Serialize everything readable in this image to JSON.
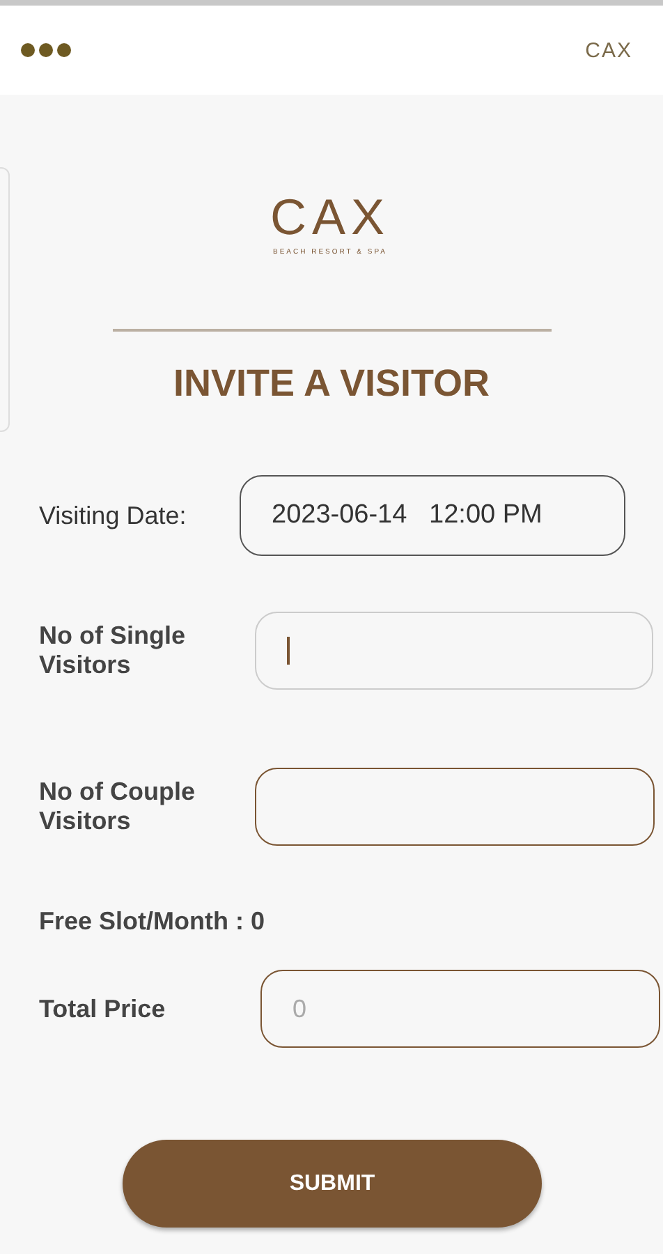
{
  "header": {
    "logo": "CAX"
  },
  "brand": {
    "logo": "CAX",
    "tagline": "BEACH RESORT & SPA"
  },
  "title": "INVITE A VISITOR",
  "fields": [
    {
      "kind": "date",
      "label": "Visiting Date:",
      "value": "2023-06-14   12:00 PM",
      "focused": false
    },
    {
      "kind": "number",
      "label": "No of Single Visitors",
      "focused": true
    },
    {
      "kind": "number",
      "label": "No of Couple Visitors",
      "focused": false
    }
  ],
  "free_slot": "Free Slot/Month : 0",
  "total": {
    "label": "Total Price",
    "placeholder": "0"
  },
  "submit": "SUBMIT"
}
